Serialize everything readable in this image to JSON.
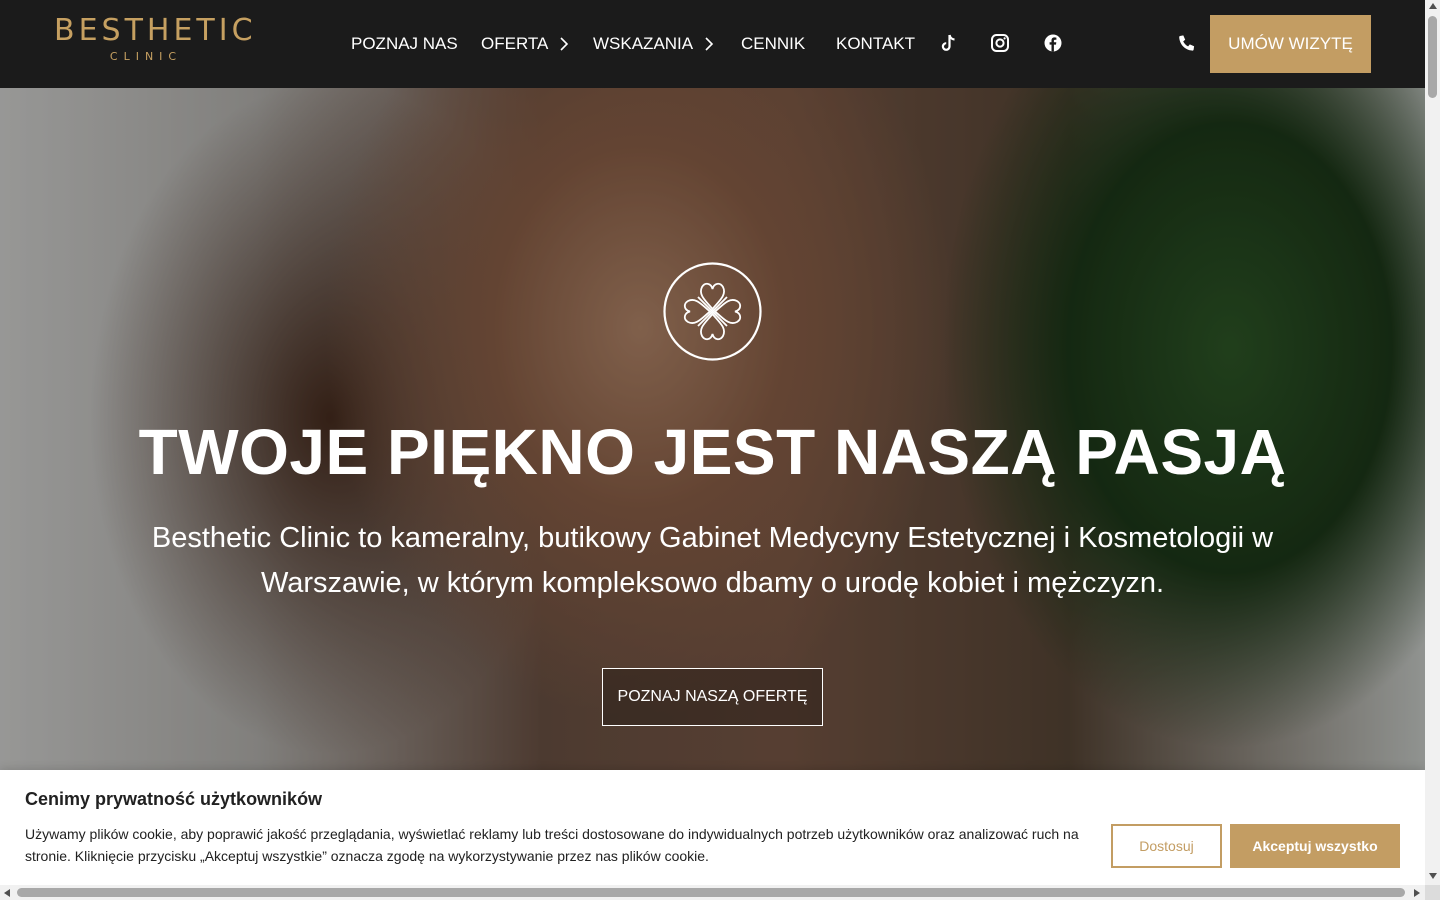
{
  "colors": {
    "accent": "#c39d63",
    "header_bg": "#1b1b1b",
    "text_light": "#ffffff",
    "text_dark": "#212121"
  },
  "header": {
    "logo_main": "BESTHETIC",
    "logo_sub": "CLINIC",
    "nav": [
      {
        "label": "POZNAJ NAS"
      },
      {
        "label": "OFERTA",
        "icon": "chevron-right-icon"
      },
      {
        "label": "WSKAZANIA",
        "icon": "chevron-right-icon"
      },
      {
        "label": "CENNIK"
      },
      {
        "label": "KONTAKT"
      }
    ],
    "social_icons": [
      "tiktok-icon",
      "instagram-icon",
      "facebook-icon"
    ],
    "phone_icon": "phone-icon",
    "cta_label": "UMÓW WIZYTĘ"
  },
  "hero": {
    "emblem_icon": "clover-hearts-emblem-icon",
    "title": "TWOJE PIĘKNO JEST NASZĄ PASJĄ",
    "text": "Besthetic Clinic to kameralny, butikowy Gabinet Medycyny Estetycznej i Kosmetologii w Warszawie, w którym kompleksowo dbamy o urodę kobiet i mężczyzn.",
    "cta_label": "POZNAJ NASZĄ OFERTĘ"
  },
  "cookie": {
    "title": "Cenimy prywatność użytkowników",
    "text": "Używamy plików cookie, aby poprawić jakość przeglądania, wyświetlać reklamy lub treści dostosowane do indywidualnych potrzeb użytkowników oraz analizować ruch na stronie. Kliknięcie przycisku „Akceptuj wszystkie” oznacza zgodę na wykorzystywanie przez nas plików cookie.",
    "customize_label": "Dostosuj",
    "accept_label": "Akceptuj wszystko"
  }
}
